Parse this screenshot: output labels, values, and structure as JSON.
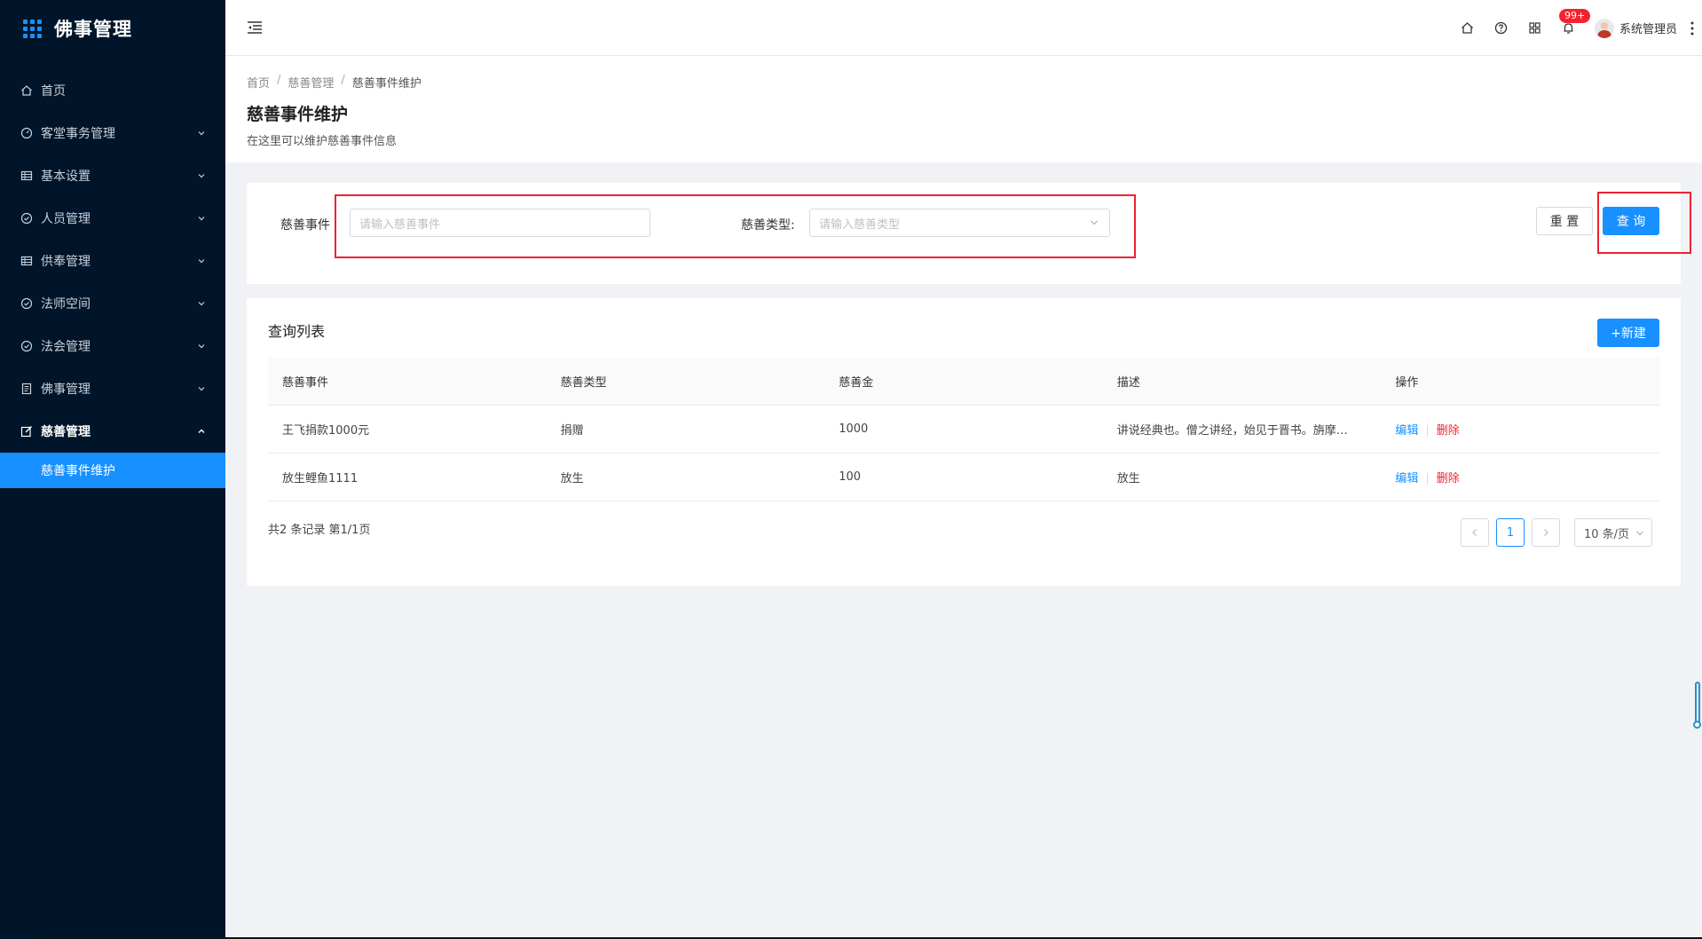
{
  "app": {
    "title": "佛事管理"
  },
  "sidebar": {
    "items": [
      {
        "label": "首页",
        "icon": "home-icon",
        "has_children": false
      },
      {
        "label": "客堂事务管理",
        "icon": "dashboard-icon",
        "has_children": true
      },
      {
        "label": "基本设置",
        "icon": "table-icon",
        "has_children": true
      },
      {
        "label": "人员管理",
        "icon": "check-circle-icon",
        "has_children": true
      },
      {
        "label": "供奉管理",
        "icon": "table-icon",
        "has_children": true
      },
      {
        "label": "法师空间",
        "icon": "check-circle-icon",
        "has_children": true
      },
      {
        "label": "法会管理",
        "icon": "check-circle-icon",
        "has_children": true
      },
      {
        "label": "佛事管理",
        "icon": "profile-icon",
        "has_children": true
      },
      {
        "label": "慈善管理",
        "icon": "edit-icon",
        "has_children": true,
        "open": true
      }
    ],
    "active_sub": "慈善事件维护"
  },
  "header": {
    "notification_count": "99+",
    "username": "系统管理员"
  },
  "breadcrumb": [
    "首页",
    "慈善管理",
    "慈善事件维护"
  ],
  "page": {
    "title": "慈善事件维护",
    "description": "在这里可以维护慈善事件信息"
  },
  "search": {
    "event_label": "慈善事件",
    "event_placeholder": "请输入慈善事件",
    "type_label": "慈善类型:",
    "type_placeholder": "请输入慈善类型",
    "reset_label": "重 置",
    "query_label": "查 询"
  },
  "list": {
    "title": "查询列表",
    "new_label": "+新建",
    "columns": [
      "慈善事件",
      "慈善类型",
      "慈善金",
      "描述",
      "操作"
    ],
    "rows": [
      {
        "event": "王飞捐款1000元",
        "type": "捐赠",
        "amount": "1000",
        "desc": "讲说经典也。僧之讲经，始见于晋书。旃摩…",
        "edit": "编辑",
        "del": "删除"
      },
      {
        "event": "放生鲤鱼1111",
        "type": "放生",
        "amount": "100",
        "desc": "放生",
        "edit": "编辑",
        "del": "删除"
      }
    ],
    "total_text": "共2 条记录 第1/1页",
    "current_page": "1",
    "page_size": "10 条/页"
  },
  "colors": {
    "sidebar_bg": "#001529",
    "primary": "#1890ff",
    "danger": "#f5222d",
    "highlight_box": "#e23333"
  }
}
